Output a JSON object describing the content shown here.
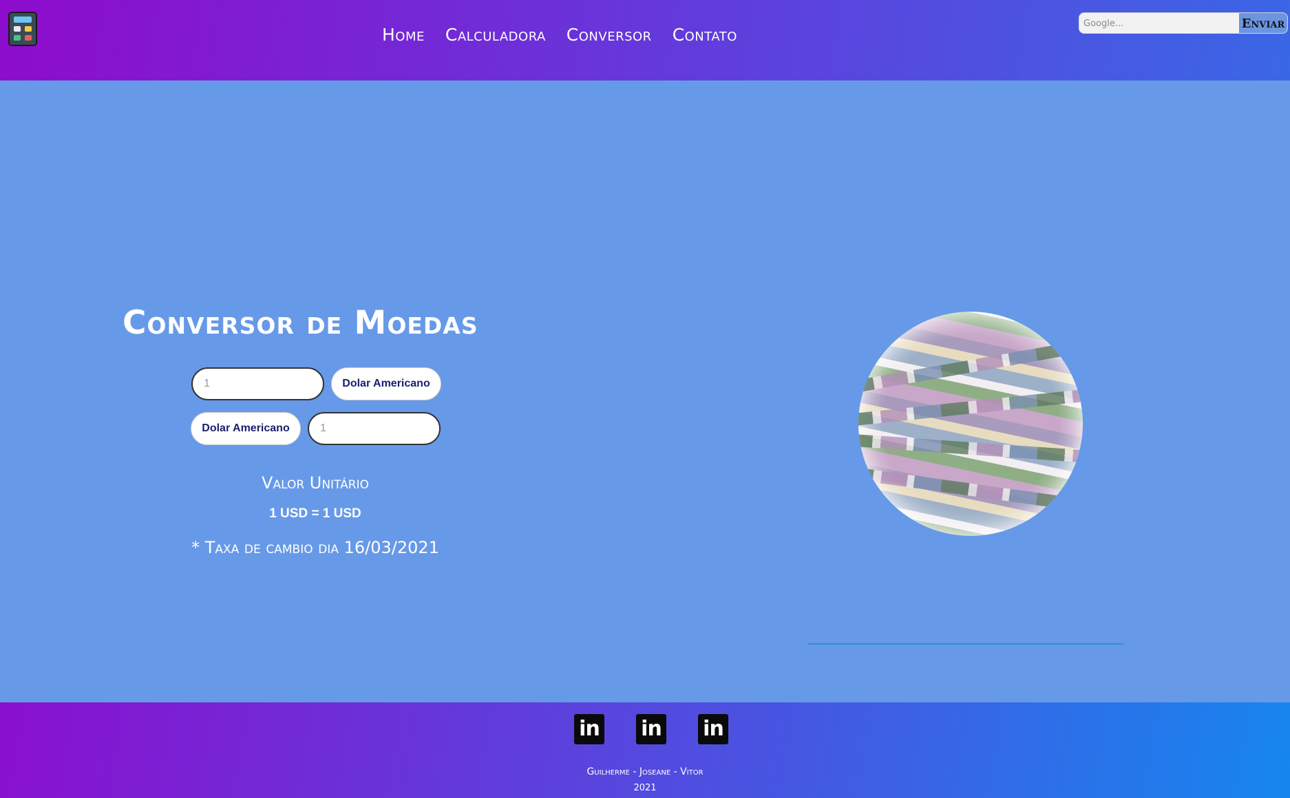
{
  "header": {
    "logo_icon": "calculator-icon",
    "nav": [
      "Home",
      "Calculadora",
      "Conversor",
      "Contato"
    ],
    "search": {
      "placeholder": "Google...",
      "button_label": "Enviar"
    }
  },
  "converter": {
    "title": "Conversor de Moedas",
    "from_value_placeholder": "1",
    "from_currency": "Dolar Americano",
    "to_currency": "Dolar Americano",
    "to_value_placeholder": "1",
    "unit_label": "Valor Unitário",
    "unit_value": "1 USD = 1 USD",
    "rate_note": "* Taxa de cambio dia 16/03/2021"
  },
  "globe_icon": "money-globe-image",
  "footer": {
    "social_icons": [
      "linkedin-icon",
      "linkedin-icon",
      "linkedin-icon"
    ],
    "social_label": "in",
    "credits": "Guilherme - Joseane - Vitor",
    "year": "2021"
  },
  "colors": {
    "background": "#6699e8",
    "header_gradient_start": "#8e0ccc",
    "header_gradient_end": "#3a67e6",
    "footer_gradient_end": "#1686ee"
  }
}
